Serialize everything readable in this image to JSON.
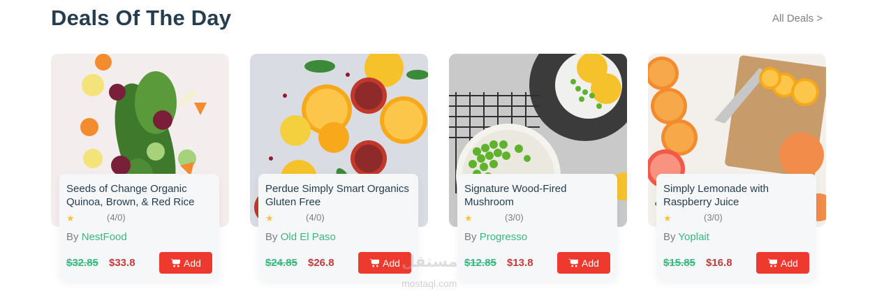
{
  "header": {
    "title": "Deals Of The Day",
    "all_deals": "All Deals >"
  },
  "colors": {
    "heading": "#253d4e",
    "brand_green": "#3bb77e",
    "price_red": "#c23b3b",
    "button_red": "#ee3a2e",
    "star": "#fdc040"
  },
  "products": [
    {
      "name": "Seeds of Change Organic Quinoa, Brown, & Red Rice",
      "rating_text": "(4/0)",
      "by": "By",
      "brand": "NestFood",
      "old_price": "$32.85",
      "price": "$33.8",
      "add_label": "Add",
      "image_icon": "vegetables-photo"
    },
    {
      "name": "Perdue Simply Smart Organics Gluten Free",
      "rating_text": "(4/0)",
      "by": "By",
      "brand": "Old El Paso",
      "old_price": "$24.85",
      "price": "$26.8",
      "add_label": "Add",
      "image_icon": "citrus-photo"
    },
    {
      "name": "Signature Wood-Fired Mushroom",
      "rating_text": "(3/0)",
      "by": "By",
      "brand": "Progresso",
      "old_price": "$12.85",
      "price": "$13.8",
      "add_label": "Add",
      "image_icon": "peas-photo"
    },
    {
      "name": "Simply Lemonade with Raspberry Juice",
      "rating_text": "(3/0)",
      "by": "By",
      "brand": "Yoplait",
      "old_price": "$15.85",
      "price": "$16.8",
      "add_label": "Add",
      "image_icon": "oranges-photo"
    }
  ],
  "watermark": {
    "arabic": "مستقل",
    "latin": "mostaql.com"
  }
}
